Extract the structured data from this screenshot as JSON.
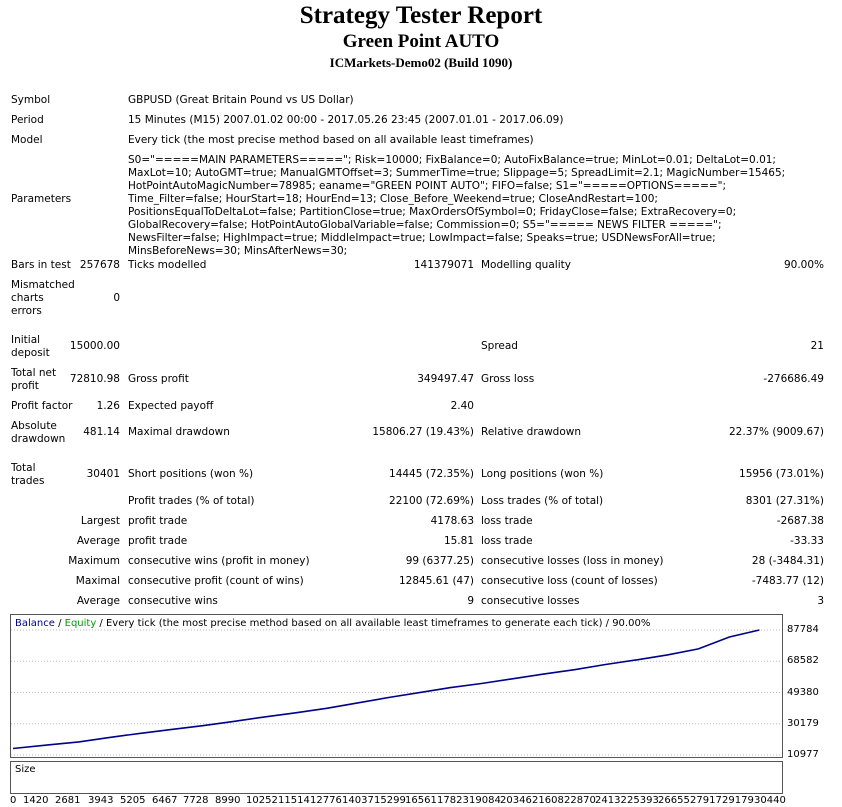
{
  "header": {
    "title": "Strategy Tester Report",
    "ea_name": "Green Point AUTO",
    "server": "ICMarkets-Demo02 (Build 1090)"
  },
  "info": {
    "symbol_label": "Symbol",
    "symbol_value": "GBPUSD (Great Britain Pound vs US Dollar)",
    "period_label": "Period",
    "period_value": "15 Minutes (M15) 2007.01.02 00:00 - 2017.05.26 23:45 (2007.01.01 - 2017.06.09)",
    "model_label": "Model",
    "model_value": "Every tick (the most precise method based on all available least timeframes)",
    "parameters_label": "Parameters",
    "parameters_value": "S0=\"=====MAIN PARAMETERS=====\"; Risk=10000; FixBalance=0; AutoFixBalance=true; MinLot=0.01; DeltaLot=0.01; MaxLot=10; AutoGMT=true; ManualGMTOffset=3; SummerTime=true; Slippage=5; SpreadLimit=2.1; MagicNumber=15465; HotPointAutoMagicNumber=78985; eaname=\"GREEN POINT AUTO\"; FIFO=false; S1=\"=====OPTIONS=====\"; Time_Filter=false; HourStart=18; HourEnd=13; Close_Before_Weekend=true; CloseAndRestart=100; PositionsEqualToDeltaLot=false; PartitionClose=true; MaxOrdersOfSymbol=0; FridayClose=false; ExtraRecovery=0; GlobalRecovery=false; HotPointAutoGlobalVariable=false; Commission=0; S5=\"===== NEWS FILTER =====\"; NewsFilter=false; HighImpact=true; MiddleImpact=true; LowImpact=false; Speaks=true; USDNewsForAll=true; MinsBeforeNews=30; MinsAfterNews=30;"
  },
  "stats": {
    "bars_label": "Bars in test",
    "bars_value": "257678",
    "ticks_label": "Ticks modelled",
    "ticks_value": "141379071",
    "quality_label": "Modelling quality",
    "quality_value": "90.00%",
    "mismatch_label_1": "Mismatched",
    "mismatch_label_2": "charts",
    "mismatch_label_3": "errors",
    "mismatch_value": "0",
    "deposit_label_1": "Initial",
    "deposit_label_2": "deposit",
    "deposit_value": "15000.00",
    "spread_label": "Spread",
    "spread_value": "21",
    "netprofit_label_1": "Total net",
    "netprofit_label_2": "profit",
    "netprofit_value": "72810.98",
    "grossprofit_label": "Gross profit",
    "grossprofit_value": "349497.47",
    "grossloss_label": "Gross loss",
    "grossloss_value": "-276686.49",
    "pf_label": "Profit factor",
    "pf_value": "1.26",
    "ep_label": "Expected payoff",
    "ep_value": "2.40",
    "absdd_label_1": "Absolute",
    "absdd_label_2": "drawdown",
    "absdd_value": "481.14",
    "maxdd_label": "Maximal drawdown",
    "maxdd_value": "15806.27 (19.43%)",
    "reldd_label": "Relative drawdown",
    "reldd_value": "22.37% (9009.67)",
    "trades_label_1": "Total",
    "trades_label_2": "trades",
    "trades_value": "30401",
    "short_label": "Short positions (won %)",
    "short_value": "14445 (72.35%)",
    "long_label": "Long positions (won %)",
    "long_value": "15956 (73.01%)",
    "profit_trades_label": "Profit trades (% of total)",
    "profit_trades_value": "22100 (72.69%)",
    "loss_trades_label": "Loss trades (% of total)",
    "loss_trades_value": "8301 (27.31%)",
    "largest_label": "Largest",
    "largest_profit_label": "profit trade",
    "largest_profit_value": "4178.63",
    "largest_loss_label": "loss trade",
    "largest_loss_value": "-2687.38",
    "average_label": "Average",
    "average_profit_label": "profit trade",
    "average_profit_value": "15.81",
    "average_loss_label": "loss trade",
    "average_loss_value": "-33.33",
    "maximum_label": "Maximum",
    "max_wins_label": "consecutive wins (profit in money)",
    "max_wins_value": "99 (6377.25)",
    "max_losses_label": "consecutive losses (loss in money)",
    "max_losses_value": "28 (-3484.31)",
    "maximal_label": "Maximal",
    "maximal_profit_label": "consecutive profit (count of wins)",
    "maximal_profit_value": "12845.61 (47)",
    "maximal_loss_label": "consecutive loss (count of losses)",
    "maximal_loss_value": "-7483.77 (12)",
    "avg_consec_label": "Average",
    "avg_wins_label": "consecutive wins",
    "avg_wins_value": "9",
    "avg_losses_label": "consecutive losses",
    "avg_losses_value": "3"
  },
  "chart_data": {
    "type": "line",
    "caption_balance": "Balance",
    "caption_sep1": " / ",
    "caption_equity": "Equity",
    "caption_rest": " / Every tick (the most precise method based on all available least timeframes to generate each tick) / 90.00%",
    "size_label": "Size",
    "balance_color": "#00008b",
    "equity_color": "#00a000",
    "size_color": "#00a000",
    "y_ticks": [
      "87784",
      "68582",
      "49380",
      "30179",
      "10977"
    ],
    "y_tick_values": [
      87784,
      68582,
      49380,
      30179,
      10977
    ],
    "ylim": [
      10977,
      87784
    ],
    "x_ticks": [
      "0",
      "1420",
      "2681",
      "3943",
      "5205",
      "6467",
      "7728",
      "8990",
      "10252",
      "11514",
      "12776",
      "14037",
      "15299",
      "16561",
      "17823",
      "19084",
      "20346",
      "21608",
      "22870",
      "24132",
      "25393",
      "26655",
      "27917",
      "29179",
      "30440"
    ],
    "xlim": [
      0,
      31200
    ],
    "series": [
      {
        "name": "Balance",
        "x": [
          0,
          1420,
          2681,
          3943,
          5205,
          6467,
          7728,
          8990,
          10252,
          11514,
          12776,
          14037,
          15299,
          16561,
          17823,
          19084,
          20346,
          21608,
          22870,
          24132,
          25393,
          26655,
          27917,
          29179,
          30401
        ],
        "values": [
          15000,
          17200,
          19000,
          21800,
          24300,
          26700,
          29000,
          31600,
          34400,
          36900,
          39700,
          43000,
          46300,
          49300,
          52400,
          54900,
          57800,
          60700,
          63400,
          66600,
          69400,
          72500,
          76200,
          83500,
          87811
        ]
      }
    ]
  }
}
